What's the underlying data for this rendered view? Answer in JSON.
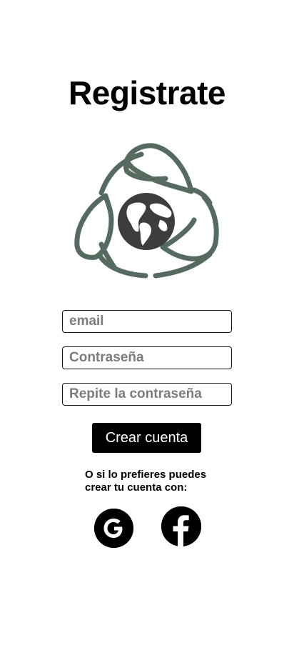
{
  "page": {
    "title": "Registrate"
  },
  "logo": {
    "icon": "recycle-globe-icon",
    "leaf_color": "#566b5f",
    "globe_color": "#3d3d3d"
  },
  "form": {
    "email_placeholder": "email",
    "password_placeholder": "Contraseña",
    "repeat_password_placeholder": "Repite la contraseña",
    "create_button_label": "Crear cuenta"
  },
  "alternative": {
    "line1": "O si lo prefieres puedes",
    "line2": "crear tu cuenta con:"
  },
  "social": {
    "google_icon": "google-icon",
    "facebook_icon": "facebook-icon"
  }
}
